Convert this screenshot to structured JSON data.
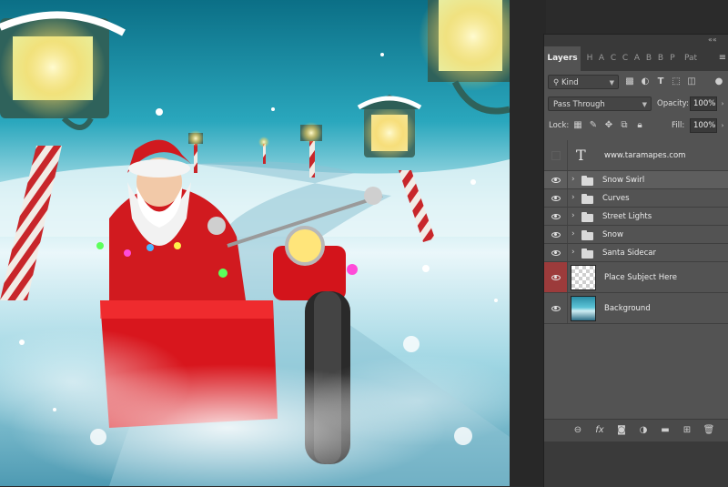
{
  "panel": {
    "tabs": [
      {
        "label": "Layers",
        "active": true
      },
      {
        "label": "H"
      },
      {
        "label": "A"
      },
      {
        "label": "C"
      },
      {
        "label": "C"
      },
      {
        "label": "A"
      },
      {
        "label": "B"
      },
      {
        "label": "B"
      },
      {
        "label": "P"
      },
      {
        "label": "Pat"
      }
    ],
    "collapse_glyph": "««",
    "menu_icon": "panel-menu-icon"
  },
  "filter": {
    "kind_label": "Kind",
    "icons": [
      "pixel-filter-icon",
      "adjustment-filter-icon",
      "type-filter-icon",
      "shape-filter-icon",
      "smart-object-filter-icon"
    ]
  },
  "blend": {
    "mode": "Pass Through",
    "opacity_label": "Opacity:",
    "opacity_value": "100%"
  },
  "lock": {
    "label": "Lock:",
    "fill_label": "Fill:",
    "fill_value": "100%"
  },
  "layers": [
    {
      "name": "www.taramapes.com",
      "type": "text",
      "visible": false
    },
    {
      "name": "Snow Swirl",
      "type": "group",
      "visible": true,
      "selected": true
    },
    {
      "name": "Curves",
      "type": "group",
      "visible": true
    },
    {
      "name": "Street Lights",
      "type": "group",
      "visible": true
    },
    {
      "name": "Snow",
      "type": "group",
      "visible": true
    },
    {
      "name": "Santa Sidecar",
      "type": "group",
      "visible": true
    },
    {
      "name": "Place Subject Here",
      "type": "pixel",
      "visible": true,
      "highlight": true
    },
    {
      "name": "Background",
      "type": "pixel",
      "visible": true
    }
  ],
  "bottom_bar": [
    "link-layers-icon",
    "fx-icon",
    "mask-icon",
    "adjustment-icon",
    "new-group-icon",
    "new-layer-icon",
    "delete-icon"
  ],
  "colors": {
    "panel_bg": "#535353",
    "selected_row": "#5e5e5e",
    "highlight_eye": "#9c3b3b",
    "sky": "#2aa7bd"
  }
}
